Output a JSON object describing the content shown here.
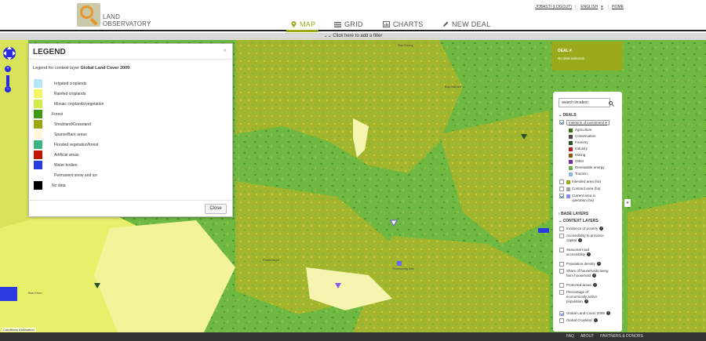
{
  "header": {
    "logo_line1": "LAND",
    "logo_line2": "OBSERVATORY",
    "nav": [
      {
        "label": "MAP",
        "icon": "map-pin-icon",
        "active": true
      },
      {
        "label": "GRID",
        "icon": "grid-icon",
        "active": false
      },
      {
        "label": "CHARTS",
        "icon": "chart-icon",
        "active": false
      },
      {
        "label": "NEW DEAL",
        "icon": "pencil-icon",
        "active": false
      }
    ],
    "user_link": "JOBASTI (LOGOUT)",
    "language": "ENGLISH",
    "language_arrow": "▾",
    "home": "HOME",
    "separator": "|"
  },
  "filterbar": {
    "label": "Click here to add a filter"
  },
  "legend": {
    "title": "LEGEND",
    "close_x": "×",
    "description_prefix": "Legend for context layer ",
    "description_layer": "Global Land Cover 2009",
    "description_suffix": ":",
    "items": [
      {
        "label": "Irrigated croplands",
        "color": "#b4e6f5"
      },
      {
        "label": "Rainfed croplands",
        "color": "#f5f564"
      },
      {
        "label": "Mosaic croplands/vegetation",
        "color": "#d2eb46"
      },
      {
        "label": "Forest",
        "color": "#3c9a14"
      },
      {
        "label": "Shrubland/Grassland",
        "color": "#a0a514"
      },
      {
        "label": "Sparse/Bare areas",
        "color": "#fff5d7"
      },
      {
        "label": "Flooded vegetation/forest",
        "color": "#3cb482"
      },
      {
        "label": "Artificial areas",
        "color": "#c31400"
      },
      {
        "label": "Water bodies",
        "color": "#283ce1"
      },
      {
        "label": "Permanent snow and ice",
        "color": "#ffffff"
      },
      {
        "label": "No data",
        "color": "#000000"
      }
    ],
    "close_button": "Close"
  },
  "deal_panel": {
    "title": "DEAL #",
    "subtitle": "No deal selected."
  },
  "layers_panel": {
    "search_placeholder": "search location",
    "deals_heading": "DEALS",
    "intention_label": "Intention of investment",
    "intention_arrow": "▾",
    "intentions": [
      {
        "label": "Agriculture",
        "color": "#3c6e14"
      },
      {
        "label": "Conservation",
        "color": "#4a4a4a"
      },
      {
        "label": "Forestry",
        "color": "#285028"
      },
      {
        "label": "Industry",
        "color": "#b41e1e"
      },
      {
        "label": "Mining",
        "color": "#8a5a14"
      },
      {
        "label": "Other",
        "color": "#7a2a9a"
      },
      {
        "label": "Renewable energy",
        "color": "#6ab04c"
      },
      {
        "label": "Tourism",
        "color": "#8ab4e6"
      }
    ],
    "area_layers": [
      {
        "label": "Intended area (ha)",
        "checked": false,
        "color": "#9aaa1a"
      },
      {
        "label": "Contract area (ha)",
        "checked": false,
        "color": "#a0a0a0"
      },
      {
        "label": "Current area in",
        "label2": "operation (ha)",
        "checked": true,
        "color": "#8a8ae6"
      }
    ],
    "base_heading": "BASE LAYERS",
    "context_heading": "CONTEXT LAYERS",
    "context_layers": [
      {
        "label": "Incidence of poverty",
        "checked": false
      },
      {
        "label": "Accessibility to province",
        "label2": "capital",
        "checked": false
      },
      {
        "label": "Seasonal road",
        "label2": "accessibility",
        "checked": false
      },
      {
        "label": "Population density",
        "checked": false
      },
      {
        "label": "Share of households being",
        "label2": "farm household",
        "checked": false
      },
      {
        "label": "Protected areas",
        "checked": false
      },
      {
        "label": "Percentage of",
        "label2": "economically active",
        "label3": "population",
        "checked": false
      },
      {
        "label": "Global Land Cover 2009",
        "checked": true
      },
      {
        "label": "Global Cropland",
        "checked": false
      }
    ],
    "info_glyph": "i"
  },
  "map": {
    "scroll_arrow": "▾",
    "attribution": "Conditions d'utilisation",
    "labels": [
      "Ban Boung",
      "Ban Nabant",
      "Phimmasan",
      "Phonsoung Mai",
      "Ban Khon"
    ],
    "zoom_in": "+",
    "zoom_out": "−",
    "zoom_mid": "◎"
  },
  "footer": {
    "links": [
      "FAQ",
      "ABOUT",
      "PARTNERS & DONORS"
    ]
  }
}
